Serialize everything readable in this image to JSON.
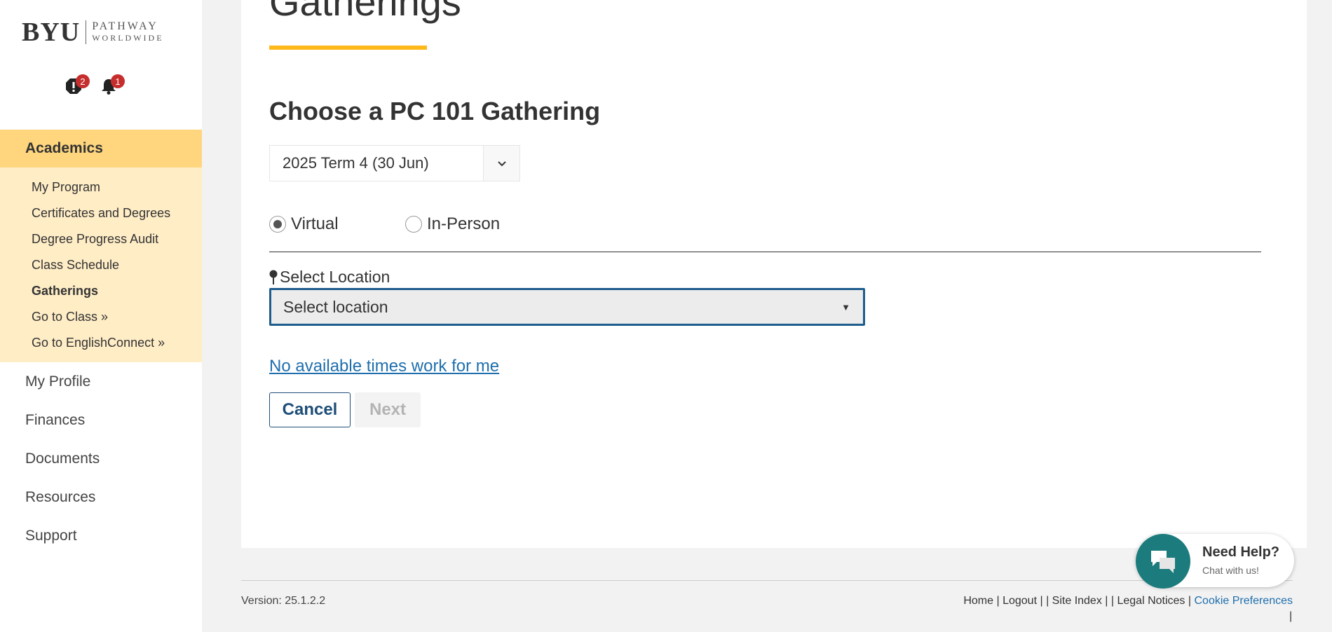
{
  "logo": {
    "main": "BYU",
    "line1": "PATHWAY",
    "line2": "WORLDWIDE"
  },
  "badges": {
    "alerts": "2",
    "notifications": "1"
  },
  "sidebar": {
    "section": "Academics",
    "sub_items": [
      {
        "label": "My Program"
      },
      {
        "label": "Certificates and Degrees"
      },
      {
        "label": "Degree Progress Audit"
      },
      {
        "label": "Class Schedule"
      },
      {
        "label": "Gatherings"
      },
      {
        "label": "Go to Class »"
      },
      {
        "label": "Go to EnglishConnect »"
      }
    ],
    "main_items": [
      {
        "label": "My Profile"
      },
      {
        "label": "Finances"
      },
      {
        "label": "Documents"
      },
      {
        "label": "Resources"
      },
      {
        "label": "Support"
      }
    ]
  },
  "main": {
    "title": "Gatherings",
    "subtitle": "Choose a PC 101 Gathering",
    "term_value": "2025 Term 4 (30 Jun)",
    "radio_virtual": "Virtual",
    "radio_inperson": "In-Person",
    "selected_mode": "Virtual",
    "location_label": "Select Location",
    "location_value": "Select location",
    "no_times_link": "No available times work for me",
    "cancel_label": "Cancel",
    "next_label": "Next"
  },
  "footer": {
    "version": "Version: 25.1.2.2",
    "home": "Home",
    "logout": "Logout",
    "site_index": "Site Index",
    "legal": "Legal Notices",
    "cookie": "Cookie Preferences"
  },
  "chat": {
    "title": "Need Help?",
    "subtitle": "Chat with us!"
  },
  "colors": {
    "academics_bg": "#ffd67e",
    "submenu_bg": "#ffedc6",
    "accent_underline": "#ffb81c",
    "link": "#1f6fad",
    "chat": "#1c7b7c",
    "badge": "#c62d2d"
  }
}
